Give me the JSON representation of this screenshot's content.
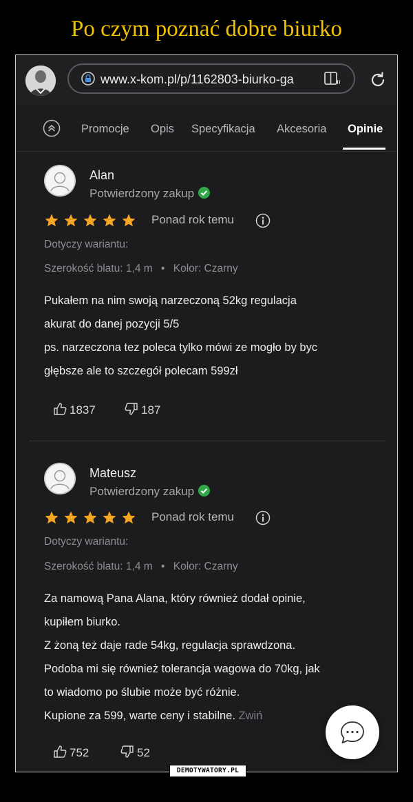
{
  "meme": {
    "title": "Po czym poznać dobre biurko",
    "watermark": "DEMOTYWATORY.PL"
  },
  "browser": {
    "url": "www.x-kom.pl/p/1162803-biurko-ga",
    "icons": [
      "profile-avatar",
      "lock-icon",
      "reader-mode-icon",
      "reload-icon"
    ]
  },
  "tabs": [
    {
      "label": "Promocje",
      "active": false
    },
    {
      "label": "Opis",
      "active": false
    },
    {
      "label": "Specyfikacja",
      "active": false
    },
    {
      "label": "Akcesoria",
      "active": false
    },
    {
      "label": "Opinie",
      "active": true
    }
  ],
  "colors": {
    "title": "#f2c200",
    "star": "#f5a623",
    "verified": "#2fa84a",
    "background": "#1c1c1e"
  },
  "reviews": [
    {
      "author": "Alan",
      "verified_label": "Potwierdzony zakup",
      "rating": 5,
      "date": "Ponad rok temu",
      "variant_label": "Dotyczy wariantu:",
      "variant_width": "Szerokość blatu: 1,4 m",
      "variant_color": "Kolor: Czarny",
      "body": [
        "Pukałem na nim swoją narzeczoną 52kg regulacja",
        "akurat do danej pozycji 5/5",
        "ps. narzeczona tez poleca tylko mówi ze mogło by byc",
        "głębsze ale to szczegół polecam 599zł"
      ],
      "likes": "1837",
      "dislikes": "187"
    },
    {
      "author": "Mateusz",
      "verified_label": "Potwierdzony zakup",
      "rating": 5,
      "date": "Ponad rok temu",
      "variant_label": "Dotyczy wariantu:",
      "variant_width": "Szerokość blatu: 1,4 m",
      "variant_color": "Kolor: Czarny",
      "body": [
        "Za namową Pana Alana, który również dodał opinie,",
        "kupiłem biurko.",
        "Z żoną też daje rade 54kg, regulacja sprawdzona.",
        "Podoba mi się również tolerancja wagowa do 70kg, jak",
        "to wiadomo po ślubie może być różnie.",
        "Kupione za 599, warte ceny i stabilne."
      ],
      "collapse_label": "Zwiń",
      "likes": "752",
      "dislikes": "52"
    }
  ]
}
